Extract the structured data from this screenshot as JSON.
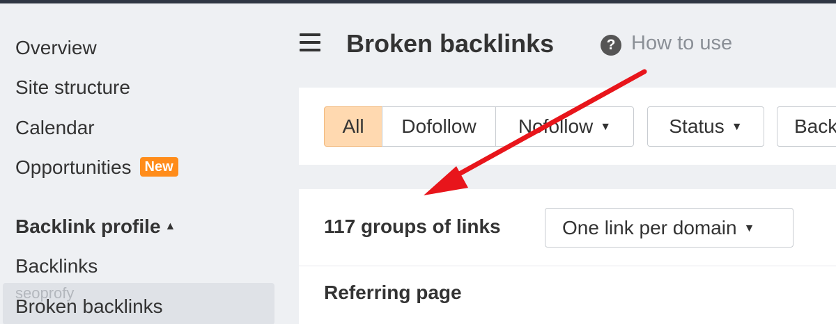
{
  "sidebar": {
    "items": [
      {
        "label": "Overview"
      },
      {
        "label": "Site structure"
      },
      {
        "label": "Calendar"
      },
      {
        "label": "Opportunities",
        "badge": "New"
      }
    ],
    "section_title": "Backlink profile",
    "section_items": [
      {
        "label": "Backlinks"
      },
      {
        "label": "Broken backlinks",
        "active": true
      }
    ],
    "ghost_text": "seoprofy"
  },
  "header": {
    "title": "Broken backlinks",
    "help_link": "How to use",
    "help_icon_glyph": "?"
  },
  "filters": {
    "all": "All",
    "dofollow": "Dofollow",
    "nofollow": "Nofollow",
    "status": "Status",
    "back": "Back"
  },
  "results": {
    "count_text": "117 groups of links",
    "grouping_select": "One link per domain"
  },
  "table": {
    "columns": [
      "Referring page"
    ]
  },
  "colors": {
    "badge": "#ff8c1a",
    "active_filter": "#ffd9b0",
    "arrow": "#e8151b",
    "topbar": "#2f3643"
  },
  "icons": [
    "hamburger-icon",
    "help-icon",
    "caret-down-icon",
    "caret-up-icon",
    "annotation-arrow"
  ]
}
